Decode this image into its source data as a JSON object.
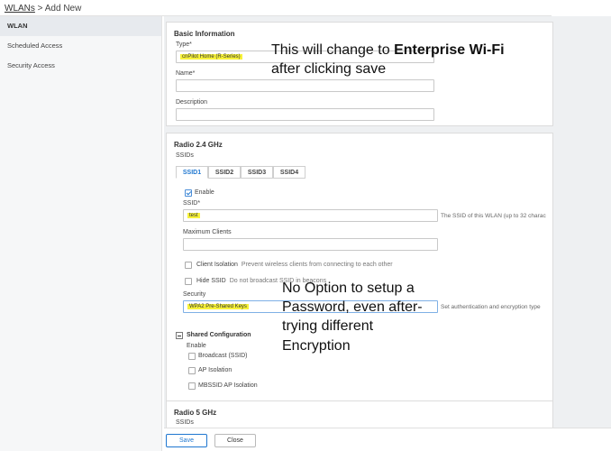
{
  "breadcrumb": {
    "link": "WLANs",
    "sep": " > ",
    "current": "Add New"
  },
  "sidebar": {
    "items": [
      {
        "label": "WLAN",
        "active": true
      },
      {
        "label": "Scheduled Access",
        "active": false
      },
      {
        "label": "Security Access",
        "active": false
      }
    ]
  },
  "basic": {
    "title": "Basic Information",
    "type_label": "Type*",
    "type_value": "cnPilot Home (R-Series)",
    "name_label": "Name*",
    "name_value": "",
    "desc_label": "Description",
    "desc_value": ""
  },
  "radio24": {
    "title": "Radio 2.4 GHz",
    "ssids_label": "SSIDs",
    "tabs": [
      "SSID1",
      "SSID2",
      "SSID3",
      "SSID4"
    ],
    "enable_label": "Enable",
    "ssid_label": "SSID*",
    "ssid_value": "test",
    "ssid_hint": "The SSID of this WLAN (up to 32 charac",
    "max_clients_label": "Maximum Clients",
    "client_isolation_label": "Client Isolation",
    "client_isolation_desc": "Prevent wireless clients from connecting to each other",
    "hide_ssid_label": "Hide SSID",
    "hide_ssid_desc": "Do not broadcast SSID in beacons",
    "security_label": "Security",
    "security_value": "WPA2 Pre-Shared Keys",
    "security_hint": "Set authentication and encryption type",
    "shared_title": "Shared Configuration",
    "shared_enable": "Enable",
    "opt_broadcast": "Broadcast (SSID)",
    "opt_ap_isolation": "AP Isolation",
    "opt_mbssid": "MBSSID AP Isolation"
  },
  "radio5": {
    "title": "Radio 5 GHz",
    "ssids_label": "SSIDs"
  },
  "footer": {
    "save": "Save",
    "close": "Close"
  },
  "annotations": {
    "note1_prefix": "This will change to ",
    "note1_bold": "Enterprise Wi-Fi",
    "note1_line2": "after clicking save",
    "note2_line1": "No Option to setup a",
    "note2_line2": "Password, even after-",
    "note2_line3": "trying different",
    "note2_line4": "Encryption"
  },
  "colors": {
    "accent": "#1f77d0",
    "highlight": "#f7f23a"
  }
}
